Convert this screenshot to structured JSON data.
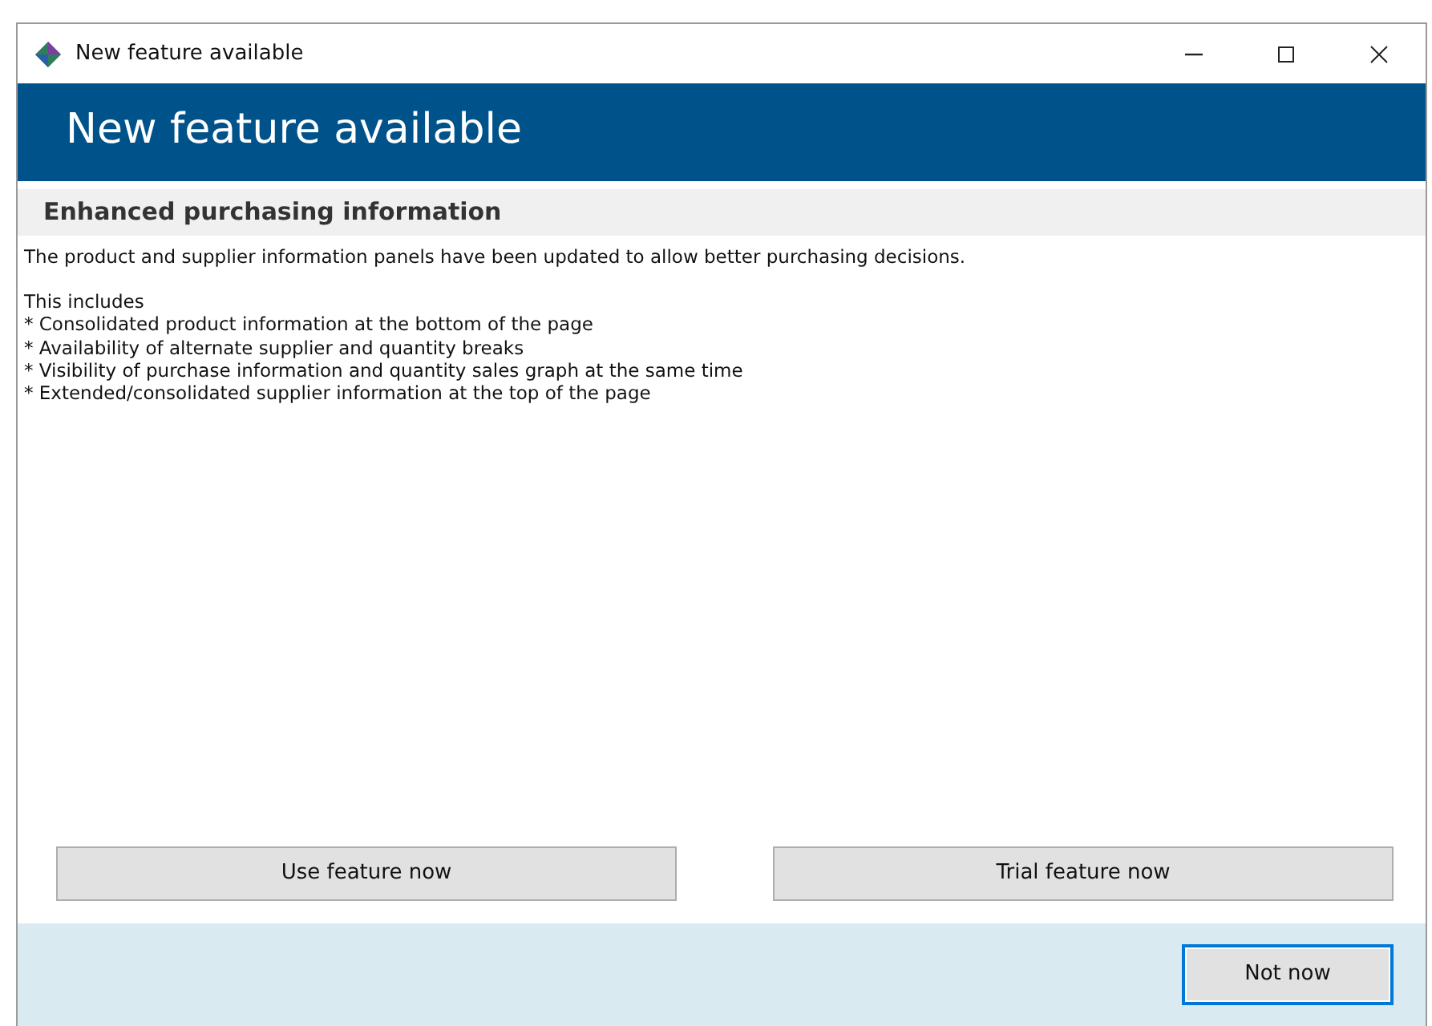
{
  "window": {
    "title": "New feature available"
  },
  "header": {
    "title": "New feature available"
  },
  "section": {
    "title": "Enhanced purchasing information"
  },
  "body": {
    "intro": "The product and supplier information panels have been updated to allow better purchasing decisions.",
    "list_title": "This includes",
    "items": [
      "* Consolidated product information at the bottom of the page",
      "* Availability of alternate supplier and quantity breaks",
      "* Visibility of purchase information and quantity sales graph at the same time",
      "* Extended/consolidated supplier information at the top of the page"
    ]
  },
  "actions": [
    {
      "label": "Use feature now"
    },
    {
      "label": "Trial feature now"
    }
  ],
  "footer": {
    "buttons": [
      {
        "label": "Not now",
        "focused": true
      }
    ]
  }
}
